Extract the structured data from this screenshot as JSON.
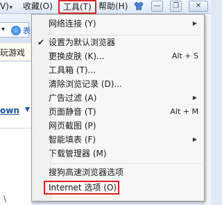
{
  "menubar": {
    "view_fragment": "V)",
    "view_arrow": "▾",
    "favorites_label": "收藏(O)",
    "tools_label": "工具(T)",
    "help_label": "帮助(H)",
    "minimize_glyph": "—",
    "restore_glyph": "❐",
    "close_glyph": "✕"
  },
  "left_fragments": {
    "address_text": "表",
    "favbar_text": "玩游戏",
    "page_link": "own",
    "page_link_arrow": "▼",
    "bottom_text": "\\"
  },
  "tools_menu": {
    "items": [
      {
        "label": "网络连接 (Y)",
        "has_submenu": true
      },
      {
        "label": "设置为默认浏览器",
        "checked": true
      },
      {
        "label": "更换皮肤 (K)...",
        "shortcut": "Alt + S"
      },
      {
        "label": "工具箱 (T)..."
      },
      {
        "label": "清除浏览记录 (D)..."
      },
      {
        "label": "广告过滤 (A)",
        "has_submenu": true
      },
      {
        "label": "页面静音 (T)",
        "shortcut": "Alt + M"
      },
      {
        "label": "网页截图 (P)"
      },
      {
        "label": "智能填表 (F)",
        "has_submenu": true
      },
      {
        "label": "下载管理器 (M)"
      },
      {
        "label": "搜狗高速浏览器选项"
      },
      {
        "label": "Internet 选项 (O)"
      }
    ]
  },
  "colors": {
    "highlight_border": "#d9231f",
    "menu_bg": "#f7f7f7",
    "menubar_bg": "#dce7f5"
  },
  "icons": {
    "shirt": "shirt-icon",
    "check": "check-icon",
    "submenu": "submenu-arrow-icon"
  }
}
